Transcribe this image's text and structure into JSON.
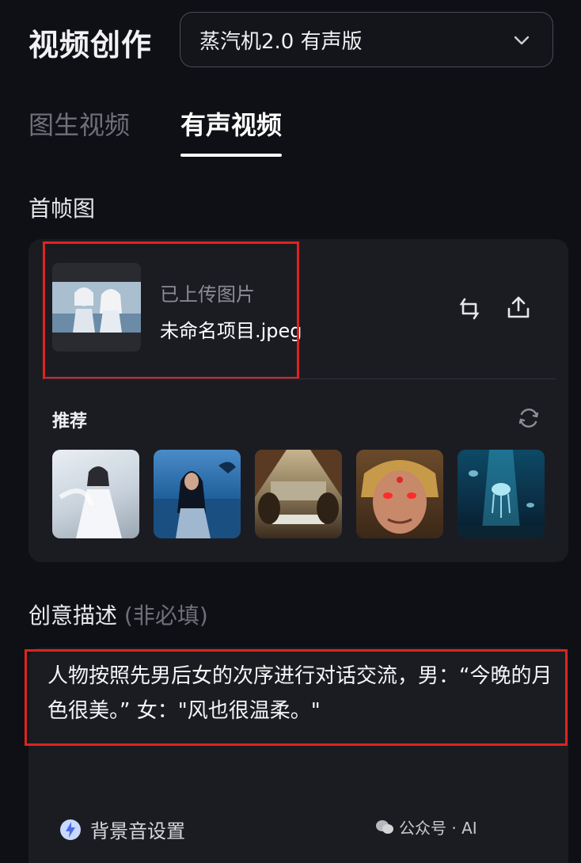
{
  "header": {
    "title": "视频创作",
    "model_select": {
      "value": "蒸汽机2.0 有声版"
    }
  },
  "tabs": [
    {
      "label": "图生视频",
      "active": false
    },
    {
      "label": "有声视频",
      "active": true
    }
  ],
  "first_frame": {
    "section_title": "首帧图",
    "upload_status": "已上传图片",
    "file_name": "未命名项目.jpeg",
    "replace_icon": "swap-icon",
    "upload_icon": "upload-icon"
  },
  "recommend": {
    "label": "推荐",
    "refresh_icon": "refresh-icon",
    "items": [
      {
        "name": "white-robe-woman-thumb"
      },
      {
        "name": "woman-by-sea-thumb"
      },
      {
        "name": "ancient-camp-thumb"
      },
      {
        "name": "monkey-king-thumb"
      },
      {
        "name": "jellyfish-cave-thumb"
      }
    ]
  },
  "creative": {
    "section_title": "创意描述",
    "optional": "(非必填)",
    "prompt": "人物按照先男后女的次序进行对话交流，男：“今晚的月色很美。” 女：\"风也很温柔。\""
  },
  "footer": {
    "bg_sound_label": "背景音设置",
    "watermark_text": "公众号 · AI"
  },
  "colors": {
    "background": "#0f1015",
    "card": "#1b1c22",
    "highlight_box": "#e0231f"
  }
}
